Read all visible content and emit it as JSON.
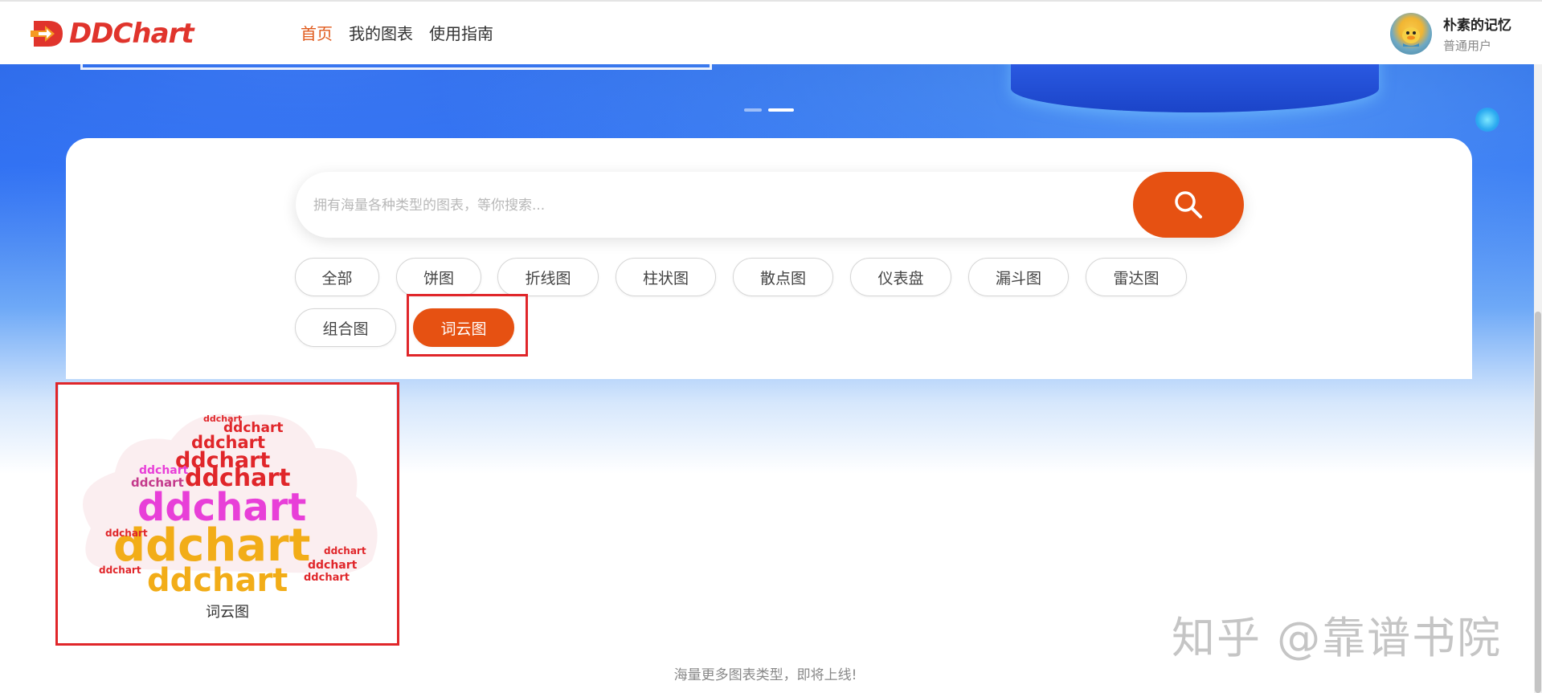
{
  "header": {
    "logo_text": "DDChart",
    "nav": [
      {
        "label": "首页",
        "active": true
      },
      {
        "label": "我的图表",
        "active": false
      },
      {
        "label": "使用指南",
        "active": false
      }
    ],
    "user": {
      "name": "朴素的记忆",
      "role": "普通用户"
    }
  },
  "search": {
    "placeholder": "拥有海量各种类型的图表，等你搜索...",
    "button_icon": "search-icon"
  },
  "categories": [
    {
      "label": "全部",
      "active": false
    },
    {
      "label": "饼图",
      "active": false
    },
    {
      "label": "折线图",
      "active": false
    },
    {
      "label": "柱状图",
      "active": false
    },
    {
      "label": "散点图",
      "active": false
    },
    {
      "label": "仪表盘",
      "active": false
    },
    {
      "label": "漏斗图",
      "active": false
    },
    {
      "label": "雷达图",
      "active": false
    },
    {
      "label": "组合图",
      "active": false
    },
    {
      "label": "词云图",
      "active": true
    }
  ],
  "cards": [
    {
      "title": "词云图",
      "preview_word": "ddchart"
    }
  ],
  "footer_note": "海量更多图表类型，即将上线!",
  "watermark": "知乎 @靠谱书院",
  "colors": {
    "accent": "#e65112",
    "nav_active": "#e05a1c",
    "highlight": "#e0262a",
    "logo": "#e0342c",
    "wordcloud": [
      "#f2ad18",
      "#e83fd8",
      "#e0262a",
      "#c43a8c"
    ]
  }
}
